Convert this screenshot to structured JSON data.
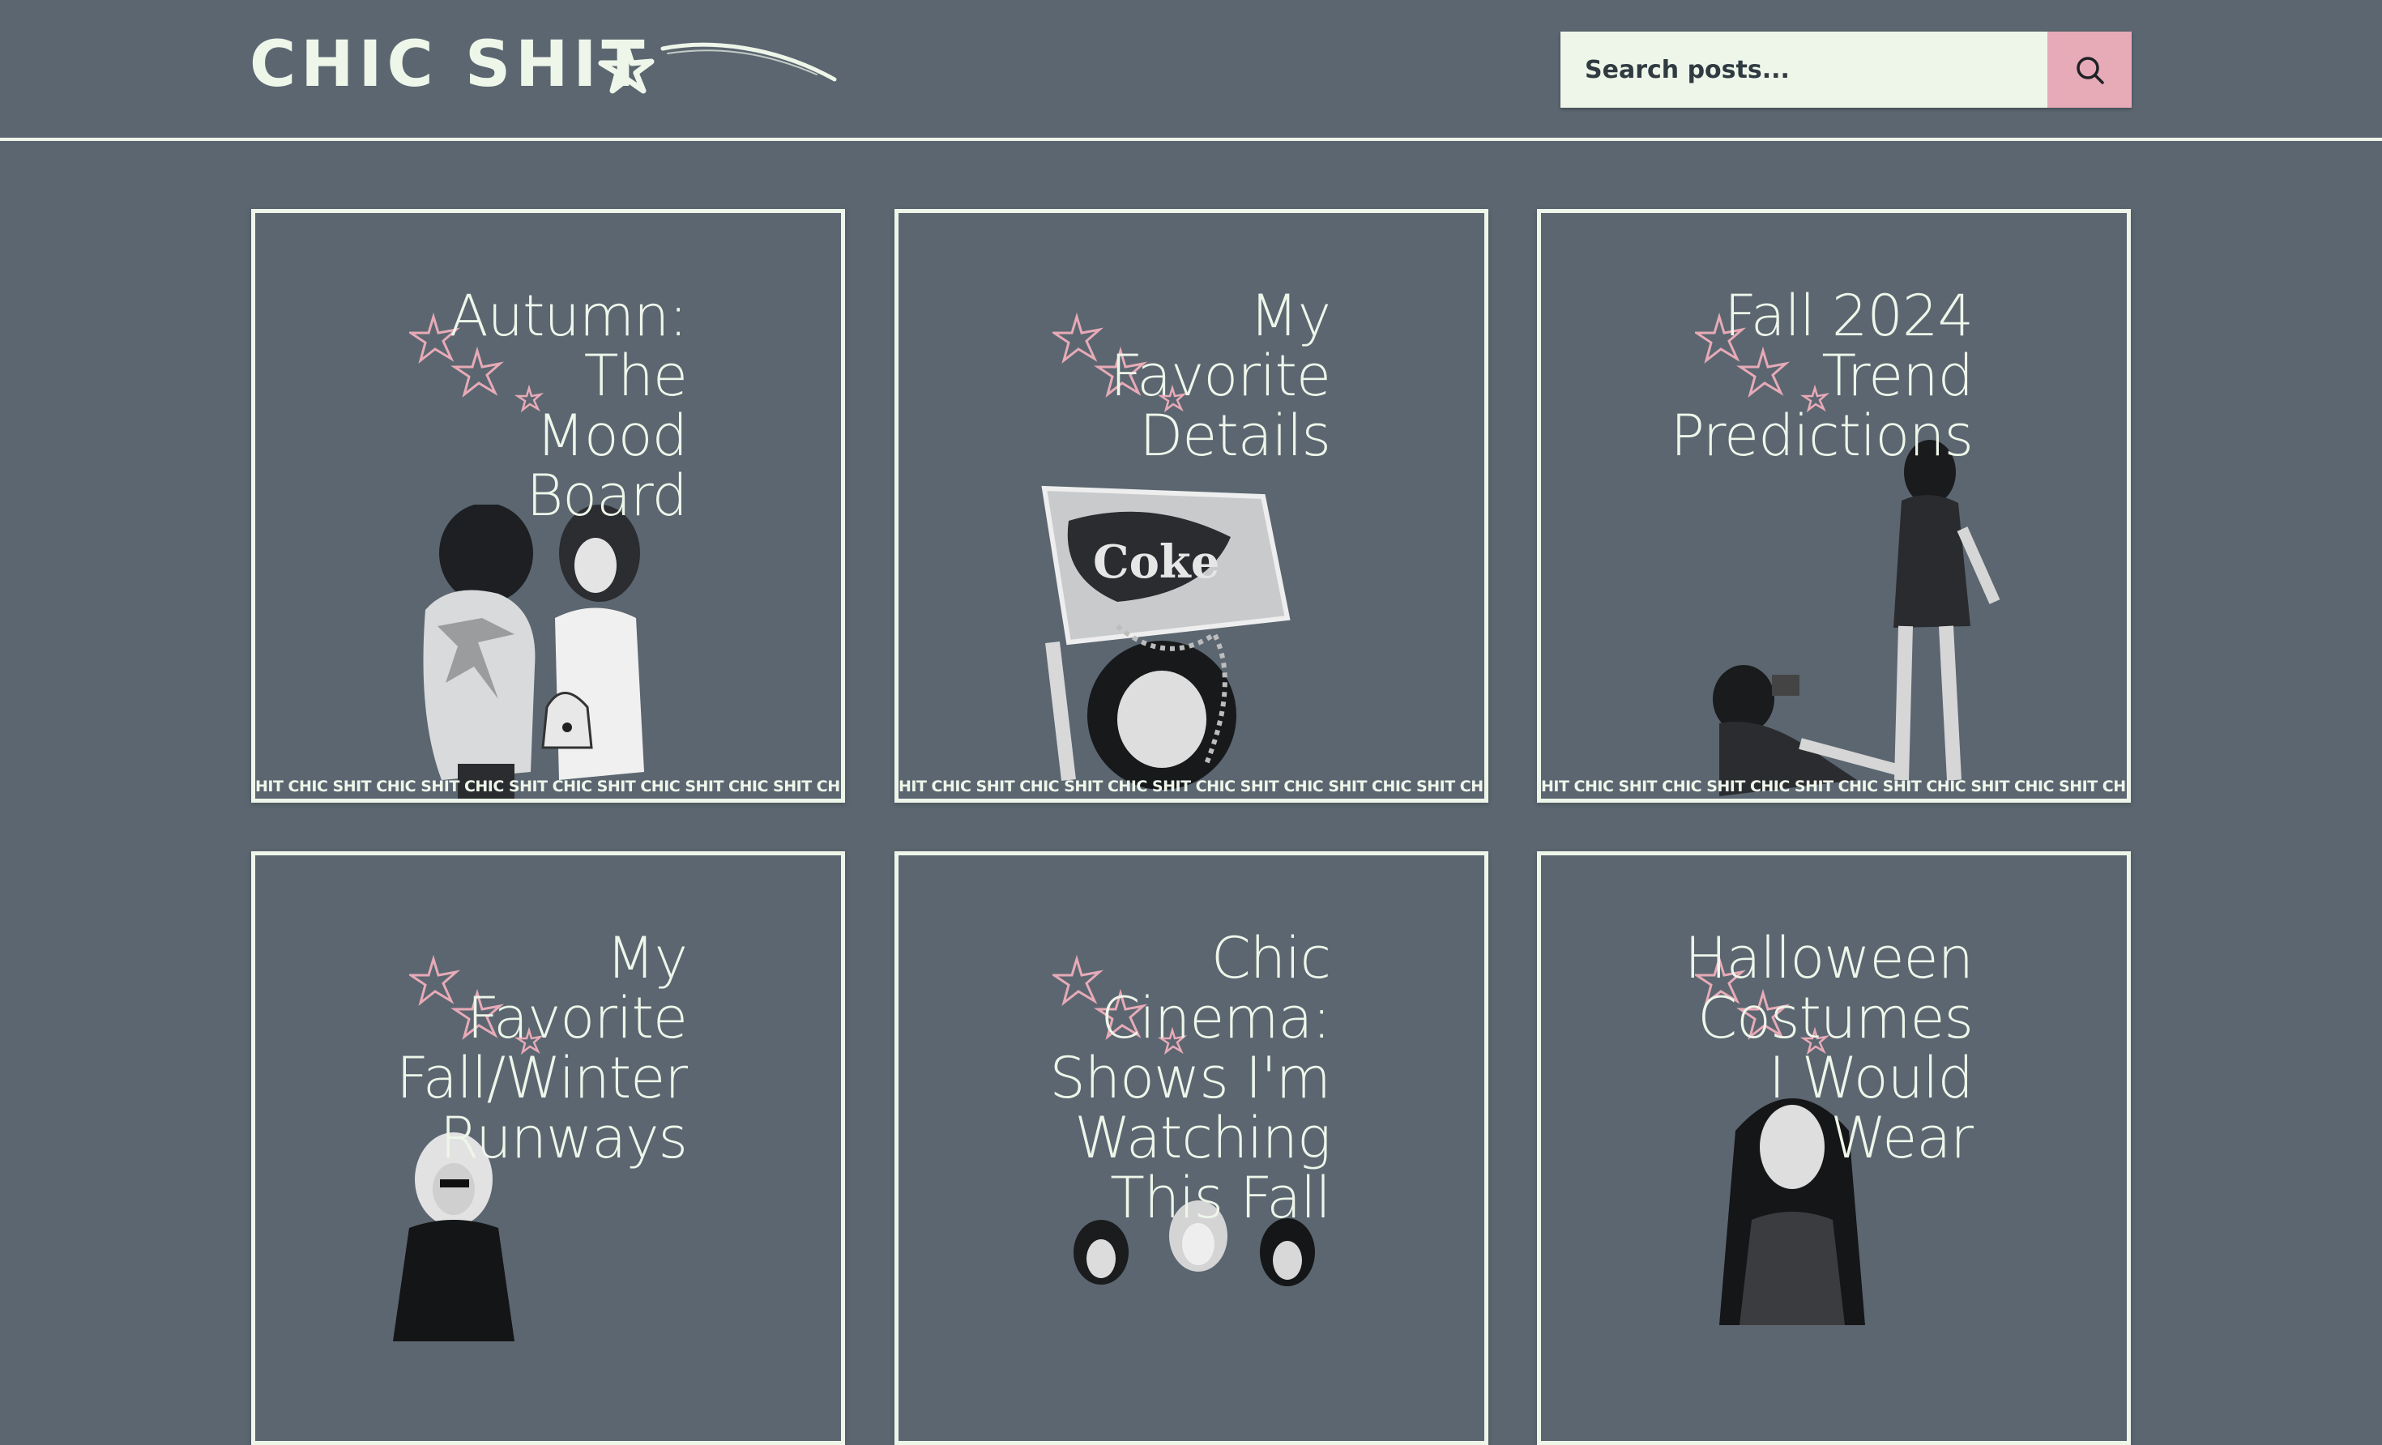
{
  "site": {
    "logo_text": "CHIC SHIT",
    "search_placeholder": "Search posts...",
    "search_icon": "search-icon",
    "colors": {
      "background": "#5b6670",
      "foreground": "#eef6ea",
      "accent_pink": "#e7aab7"
    }
  },
  "posts": [
    {
      "title": "Autumn:\nThe\nMood\nBoard",
      "ticker": "HIT CHIC SHIT CHIC SHIT CHIC SHIT CHIC SHIT CHIC SHIT CHIC SHIT CHIC SHIT CHIC SHIT CHIC"
    },
    {
      "title": "My\nFavorite\nDetails",
      "ticker": "HIT CHIC SHIT CHIC SHIT CHIC SHIT CHIC SHIT CHIC SHIT CHIC SHIT CHIC SHIT CHIC SHIT CHIC"
    },
    {
      "title": "Fall 2024\nTrend\nPredictions",
      "ticker": "HIT CHIC SHIT CHIC SHIT CHIC SHIT CHIC SHIT CHIC SHIT CHIC SHIT CHIC SHIT CHIC SHIT CHIC"
    },
    {
      "title": "My\nFavorite\nFall/Winter\nRunways",
      "ticker": ""
    },
    {
      "title": "Chic\nCinema:\nShows I'm\nWatching\nThis Fall",
      "ticker": ""
    },
    {
      "title": "Halloween\nCostumes\nI Would\nWear",
      "ticker": ""
    }
  ]
}
